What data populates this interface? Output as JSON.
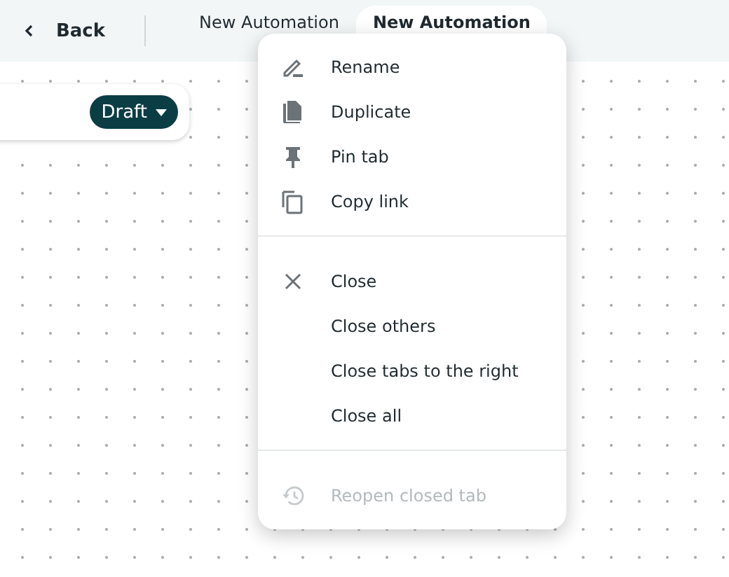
{
  "header": {
    "back_label": "Back"
  },
  "tabs": [
    {
      "label": "New Automation",
      "selected": false
    },
    {
      "label": "New Automation",
      "selected": true
    }
  ],
  "card": {
    "status": "Draft"
  },
  "context_menu": {
    "sections": [
      {
        "items": [
          {
            "label": "Rename",
            "kind": "pencil",
            "disabled": false
          },
          {
            "label": "Duplicate",
            "kind": "file",
            "disabled": false
          },
          {
            "label": "Pin tab",
            "kind": "pin",
            "disabled": false
          },
          {
            "label": "Copy link",
            "kind": "copy",
            "disabled": false
          }
        ]
      },
      {
        "items": [
          {
            "label": "Close",
            "kind": "close",
            "disabled": false
          },
          {
            "label": "Close others",
            "kind": "plain",
            "disabled": false
          },
          {
            "label": "Close tabs to the right",
            "kind": "plain",
            "disabled": false
          },
          {
            "label": "Close all",
            "kind": "plain",
            "disabled": false
          }
        ]
      },
      {
        "items": [
          {
            "label": "Reopen closed tab",
            "kind": "history",
            "disabled": true
          }
        ]
      }
    ]
  }
}
